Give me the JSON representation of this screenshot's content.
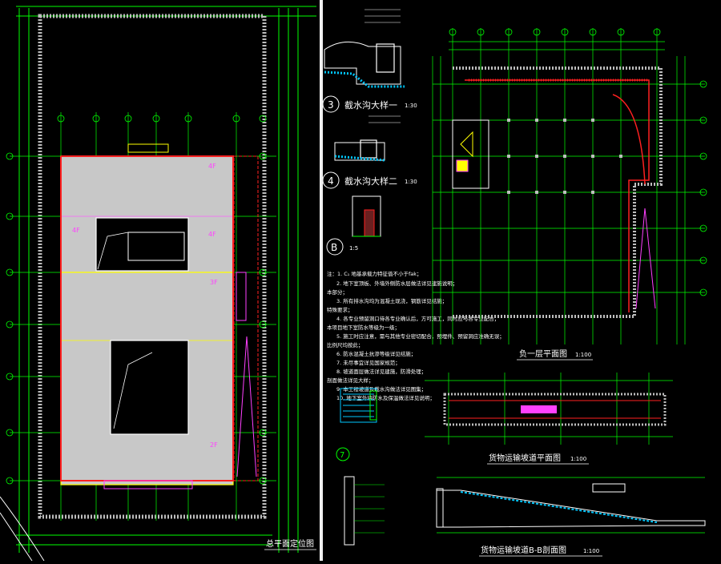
{
  "colors": {
    "background": "#000000",
    "grid": "#00ff00",
    "wall_red": "#ff2020",
    "wall_yellow": "#ffff00",
    "floor_fill": "#c8c8c8",
    "label_magenta": "#ff40ff",
    "text_white": "#ffffff",
    "hatch_cyan": "#00c8ff"
  },
  "site_plan": {
    "title": "总平面定位图",
    "floor_labels": [
      "4F",
      "4F",
      "4F",
      "3F",
      "2F"
    ],
    "grid_rows": [
      "A",
      "B",
      "C",
      "D",
      "E",
      "F",
      "G"
    ],
    "grid_cols": [
      "1",
      "2",
      "3",
      "4",
      "5",
      "6"
    ]
  },
  "details": {
    "detail3": {
      "num": "3",
      "title": "截水沟大样一",
      "scale": "1:30"
    },
    "detail4": {
      "num": "4",
      "title": "截水沟大样二",
      "scale": "1:30"
    },
    "detailB": {
      "num": "B",
      "scale": "1:5"
    },
    "detail7": {
      "num": "7"
    }
  },
  "basement": {
    "title": "负一层平面图",
    "scale": "1:100",
    "grid_cols": [
      "1",
      "2",
      "3",
      "4",
      "5",
      "6",
      "7",
      "8",
      "9",
      "10",
      "11"
    ],
    "grid_rows": [
      "A",
      "B",
      "C",
      "D",
      "E",
      "F",
      "G"
    ]
  },
  "notes": {
    "lines": [
      "注：1. C₁ 地基承载力特征值不小于fak；",
      "2. 地下室顶板、外墙外侧防水层做法详见建施说明；",
      "本部分；",
      "3. 所有排水沟均为混凝土现浇，钢筋详见结施；",
      "特殊要求；",
      "4. 各专业预留洞口待各专业确认后，方可施工，同时应与各专业配合；",
      "本项目地下室防水等级为一级；",
      "5. 施工时应注意，需与其他专业密切配合，预埋件、预留洞应准确无误；",
      "比例尺均按此；",
      "6. 防水混凝土抗渗等级详见结施；",
      "7. 未尽事宜详见国家规范；",
      "8. 坡道面层做法详见建施，防滑处理；",
      "剖面做法详见大样；",
      "9. 本工程坡道及截水沟做法详见图集；",
      "10. 地下室外墙防水及保温做法详见说明；"
    ]
  },
  "ramp_plan": {
    "title": "货物运输坡道平面图",
    "scale": "1:100"
  },
  "ramp_section": {
    "title": "货物运输坡道B-B剖面图",
    "scale": "1:100"
  }
}
